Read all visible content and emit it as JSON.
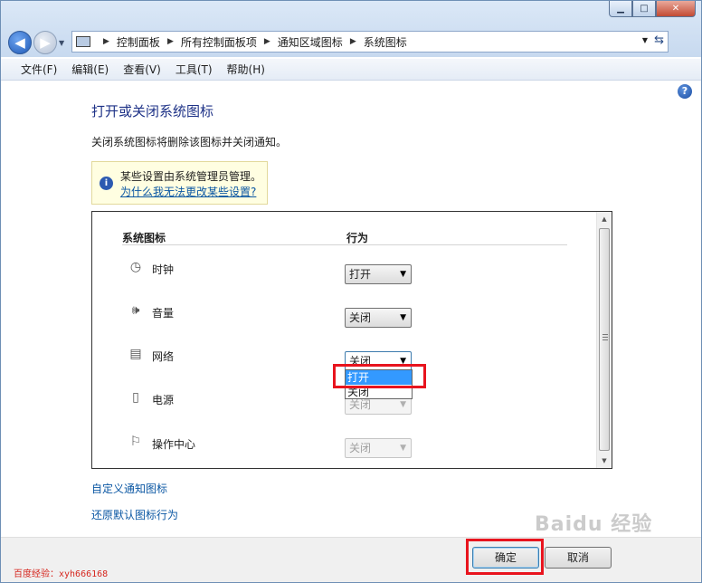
{
  "titlebar": {
    "minimize": "▁",
    "maximize": "□",
    "close": "✕"
  },
  "nav": {
    "breadcrumb": [
      "控制面板",
      "所有控制面板项",
      "通知区域图标",
      "系统图标"
    ]
  },
  "menu": [
    "文件(F)",
    "编辑(E)",
    "查看(V)",
    "工具(T)",
    "帮助(H)"
  ],
  "help_glyph": "?",
  "page": {
    "title": "打开或关闭系统图标",
    "description": "关闭系统图标将删除该图标并关闭通知。"
  },
  "notice": {
    "icon": "i",
    "text": "某些设置由系统管理员管理。",
    "link": "为什么我无法更改某些设置?"
  },
  "table": {
    "col_icon": "系统图标",
    "col_behavior": "行为",
    "rows": [
      {
        "name": "时钟",
        "icon": "clock-icon",
        "value": "打开",
        "disabled": false
      },
      {
        "name": "音量",
        "icon": "volume-icon",
        "value": "关闭",
        "disabled": false
      },
      {
        "name": "网络",
        "icon": "network-icon",
        "value": "关闭",
        "disabled": false
      },
      {
        "name": "电源",
        "icon": "power-icon",
        "value": "关闭",
        "disabled": true
      },
      {
        "name": "操作中心",
        "icon": "flag-icon",
        "value": "关闭",
        "disabled": true
      }
    ]
  },
  "dropdown": {
    "options": [
      "打开",
      "关闭"
    ],
    "selected": "打开"
  },
  "links": {
    "customize": "自定义通知图标",
    "restore": "还原默认图标行为"
  },
  "buttons": {
    "ok": "确定",
    "cancel": "取消"
  },
  "watermark": "百度经验：xyh666168",
  "logo_text": "Baidu 经验",
  "colors": {
    "highlight_box": "#e8141e",
    "selection": "#3399ff",
    "link": "#0b57a3",
    "title": "#1e3287"
  }
}
